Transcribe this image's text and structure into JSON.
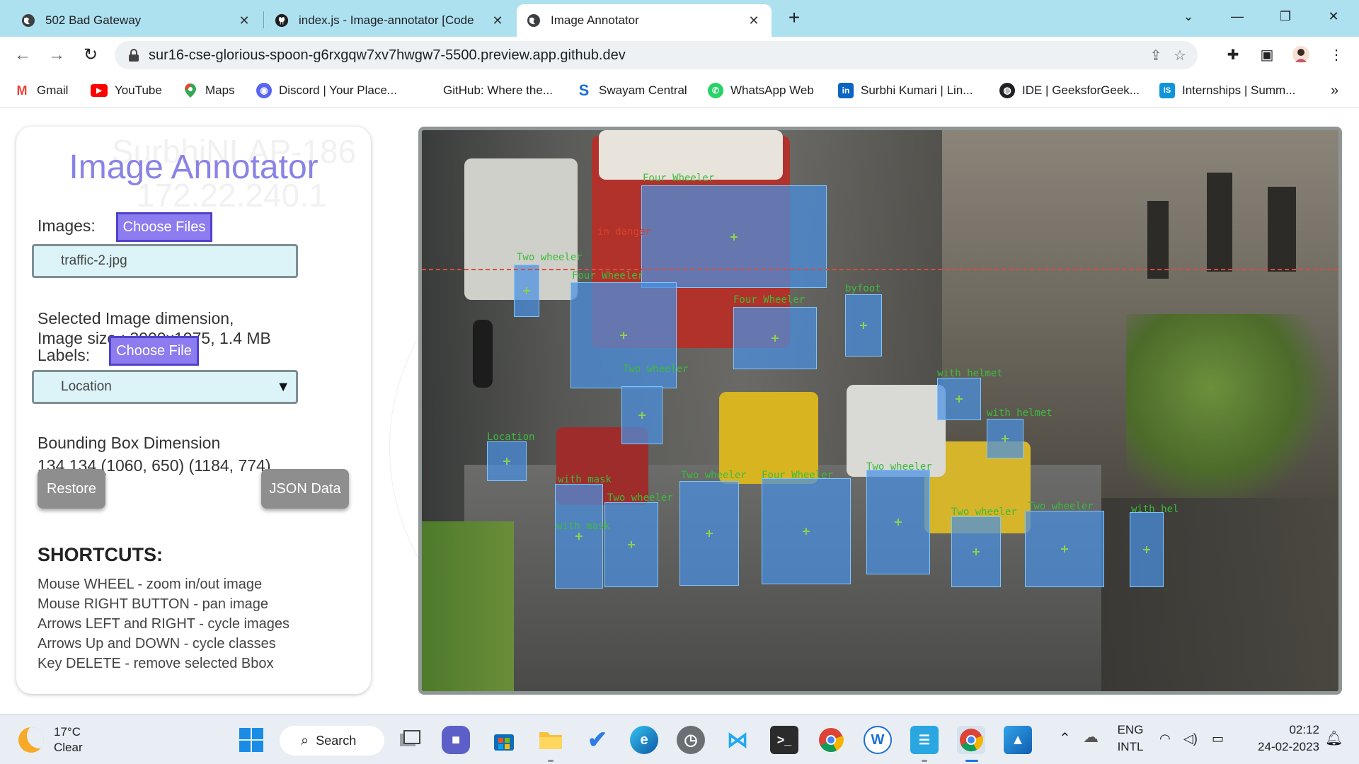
{
  "browser": {
    "tabs": [
      {
        "title": "502 Bad Gateway",
        "icon": "globe-icon",
        "active": false
      },
      {
        "title": "index.js - Image-annotator [Code",
        "icon": "github-icon",
        "active": false
      },
      {
        "title": "Image Annotator",
        "icon": "globe-icon",
        "active": true
      }
    ],
    "url": "sur16-cse-glorious-spoon-g6rxgqw7xv7hwgw7-5500.preview.app.github.dev",
    "bookmarks": [
      {
        "label": "Gmail",
        "icon": "gmail-icon",
        "color": "#ea4335",
        "glyph": "M"
      },
      {
        "label": "YouTube",
        "icon": "youtube-icon",
        "color": "#ff0000",
        "glyph": "▶"
      },
      {
        "label": "Maps",
        "icon": "maps-icon",
        "color": "#34a853",
        "glyph": "⬤"
      },
      {
        "label": "Discord | Your Place...",
        "icon": "discord-icon",
        "color": "#5865f2",
        "glyph": "◉"
      },
      {
        "label": "GitHub: Where the...",
        "icon": "",
        "color": "",
        "glyph": ""
      },
      {
        "label": "Swayam Central",
        "icon": "swayam-icon",
        "color": "#1c6fd6",
        "glyph": "S"
      },
      {
        "label": "WhatsApp Web",
        "icon": "whatsapp-icon",
        "color": "#25d366",
        "glyph": "✆"
      },
      {
        "label": "Surbhi Kumari | Lin...",
        "icon": "linkedin-icon",
        "color": "#0a66c2",
        "glyph": "in"
      },
      {
        "label": "IDE | GeeksforGeek...",
        "icon": "globe-icon",
        "color": "#202124",
        "glyph": "◍"
      },
      {
        "label": "Internships | Summ...",
        "icon": "internshala-icon",
        "color": "#1295d8",
        "glyph": "IS"
      }
    ],
    "bookmarks_more": "»"
  },
  "app": {
    "title": "Image Annotator",
    "watermark_line1": "SurbhiNLAP-186",
    "watermark_line2": "172.22.240.1",
    "images_label": "Images:",
    "choose_files_label": "Choose Files",
    "image_select_value": "traffic-2.jpg",
    "selected_dim_line1": "Selected Image dimension,",
    "selected_dim_line2": "Image size : 3000x1975, 1.4 MB",
    "labels_label": "Labels:",
    "choose_file_label": "Choose File",
    "class_select_value": "Location",
    "bbox_dim_title": "Bounding Box Dimension",
    "bbox_dim_values": "134 134 (1060, 650) (1184, 774)",
    "restore_label": "Restore",
    "json_label": "JSON Data",
    "shortcuts_title": "SHORTCUTS:",
    "shortcuts": [
      "Mouse WHEEL - zoom in/out image",
      "Mouse RIGHT BUTTON - pan image",
      "Arrows LEFT and RIGHT - cycle images",
      "Arrows Up and DOWN - cycle classes",
      "Key DELETE - remove selected Bbox"
    ]
  },
  "annotations": [
    {
      "label": "Four Wheeler"
    },
    {
      "label": "in danger"
    },
    {
      "label": "Two wheeler"
    },
    {
      "label": "Four Wheeler"
    },
    {
      "label": "Four Wheeler"
    },
    {
      "label": "byfoot"
    },
    {
      "label": "Two wheeler"
    },
    {
      "label": "with helmet"
    },
    {
      "label": "with helmet"
    },
    {
      "label": "Location"
    },
    {
      "label": "with mask"
    },
    {
      "label": "Two wheeler"
    },
    {
      "label": "Two wheeler"
    },
    {
      "label": "Four Wheeler"
    },
    {
      "label": "Two wheeler"
    },
    {
      "label": "Two wheeler"
    },
    {
      "label": "Two wheeler"
    },
    {
      "label": "with hel"
    },
    {
      "label": "with mask"
    }
  ],
  "taskbar": {
    "temperature": "17°C",
    "condition": "Clear",
    "search_label": "Search",
    "lang_top": "ENG",
    "lang_bottom": "INTL",
    "time": "02:12",
    "date": "24-02-2023"
  }
}
